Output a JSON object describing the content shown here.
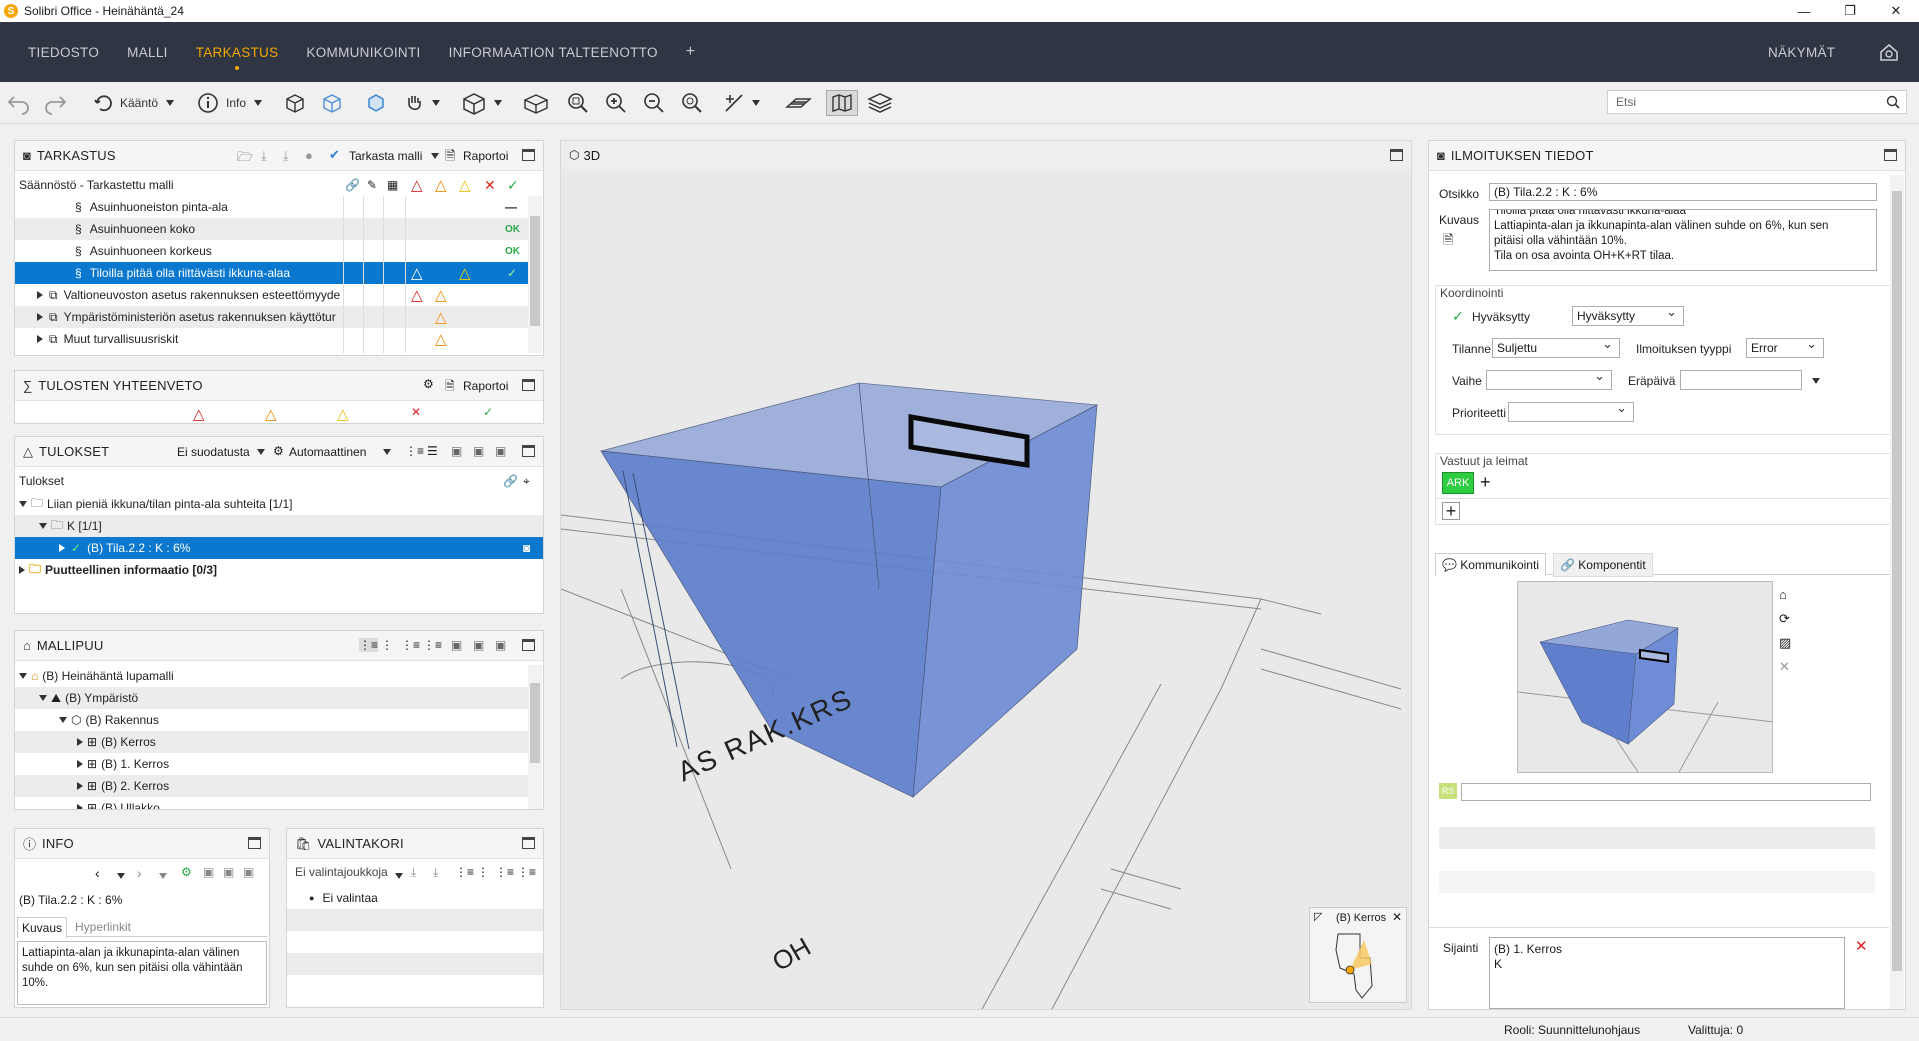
{
  "window": {
    "title": "Solibri Office - Heinähäntä_24",
    "app_icon": "S"
  },
  "menu": {
    "items": [
      "TIEDOSTO",
      "MALLI",
      "TARKASTUS",
      "KOMMUNIKOINTI",
      "INFORMAATION TALTEENOTTO"
    ],
    "active": "TARKASTUS",
    "add": "+",
    "views": "NÄKYMÄT"
  },
  "toolbar": {
    "rotate_label": "Kääntö",
    "info_label": "Info",
    "search_placeholder": "Etsi"
  },
  "tarkastus": {
    "title": "TARKASTUS",
    "check_model": "Tarkasta malli",
    "report": "Raportoi",
    "header": "Säännöstö - Tarkastettu malli",
    "rows": [
      {
        "label": "Asuinhuoneiston pinta-ala",
        "status": "—"
      },
      {
        "label": "Asuinhuoneen koko",
        "status": "OK"
      },
      {
        "label": "Asuinhuoneen korkeus",
        "status": "OK"
      },
      {
        "label": "Tiloilla pitää olla riittävästi ikkuna-alaa"
      },
      {
        "label": "Valtioneuvoston asetus rakennuksen esteettömyyde"
      },
      {
        "label": "Ympäristöministeriön asetus rakennuksen käyttötur"
      },
      {
        "label": "Muut turvallisuusriskit"
      }
    ]
  },
  "yhteenveto": {
    "title": "TULOSTEN YHTEENVETO",
    "report": "Raportoi"
  },
  "tulokset": {
    "title": "TULOKSET",
    "filter": "Ei suodatusta",
    "mode": "Automaattinen",
    "header": "Tulokset",
    "rows": [
      "Liian pieniä ikkuna/tilan pinta-ala suhteita [1/1]",
      "K [1/1]",
      "(B) Tila.2.2 : K : 6%",
      "Puutteellinen informaatio [0/3]"
    ]
  },
  "mallipuu": {
    "title": "MALLIPUU",
    "rows": [
      "(B) Heinähäntä lupamalli",
      "(B) Ympäristö",
      "(B) Rakennus",
      "(B) Kerros",
      "(B) 1. Kerros",
      "(B) 2. Kerros",
      "(B) Ullakko"
    ]
  },
  "info": {
    "title": "INFO",
    "selected": "(B) Tila.2.2 : K : 6%",
    "tabs": [
      "Kuvaus",
      "Hyperlinkit"
    ],
    "description": "Lattiapinta-alan ja ikkunapinta-alan välinen suhde on 6%, kun sen pitäisi olla vähintään 10%."
  },
  "valintakori": {
    "title": "VALINTAKORI",
    "sets": "Ei valintajoukkoja",
    "empty": "Ei valintaa"
  },
  "view3d": {
    "title": "3D",
    "floor_texts": [
      "AS RAK.KRS",
      "OH"
    ],
    "minimap_label": "(B) Kerros"
  },
  "ilmoitus": {
    "title": "ILMOITUKSEN TIEDOT",
    "otsikko_label": "Otsikko",
    "otsikko": "(B) Tila.2.2 : K : 6%",
    "kuvaus_label": "Kuvaus",
    "kuvaus_lines": [
      "Tiloilla pitää olla riittävästi ikkuna-alaa",
      "Lattiapinta-alan ja ikkunapinta-alan välinen suhde on 6%, kun sen pitäisi olla vähintään 10%.",
      "Tila on osa avointa OH+K+RT tilaa."
    ],
    "koordinointi": "Koordinointi",
    "hyvaksytty_label": "Hyväksytty",
    "hyvaksytty_value": "Hyväksytty",
    "tilanne_label": "Tilanne",
    "tilanne_value": "Suljettu",
    "tyyppi_label": "Ilmoituksen tyyppi",
    "tyyppi_value": "Error",
    "vaihe_label": "Vaihe",
    "erapaiva_label": "Eräpäivä",
    "prioriteetti_label": "Prioriteetti",
    "vastuut_label": "Vastuut ja leimat",
    "tag": "ARK",
    "tab_comm": "Kommunikointi",
    "tab_comp": "Komponentit",
    "user_badge": "RS",
    "sijainti_label": "Sijainti",
    "sijainti_lines": [
      "(B) 1. Kerros",
      "K"
    ]
  },
  "status": {
    "role": "Rooli: Suunnittelunohjaus",
    "selected": "Valittuja: 0"
  },
  "colors": {
    "menu_bg": "#2f3542",
    "accent": "#f5a700",
    "selection": "#0b78d0",
    "box": "#5b7fd0",
    "tag_green": "#2ecc40"
  }
}
